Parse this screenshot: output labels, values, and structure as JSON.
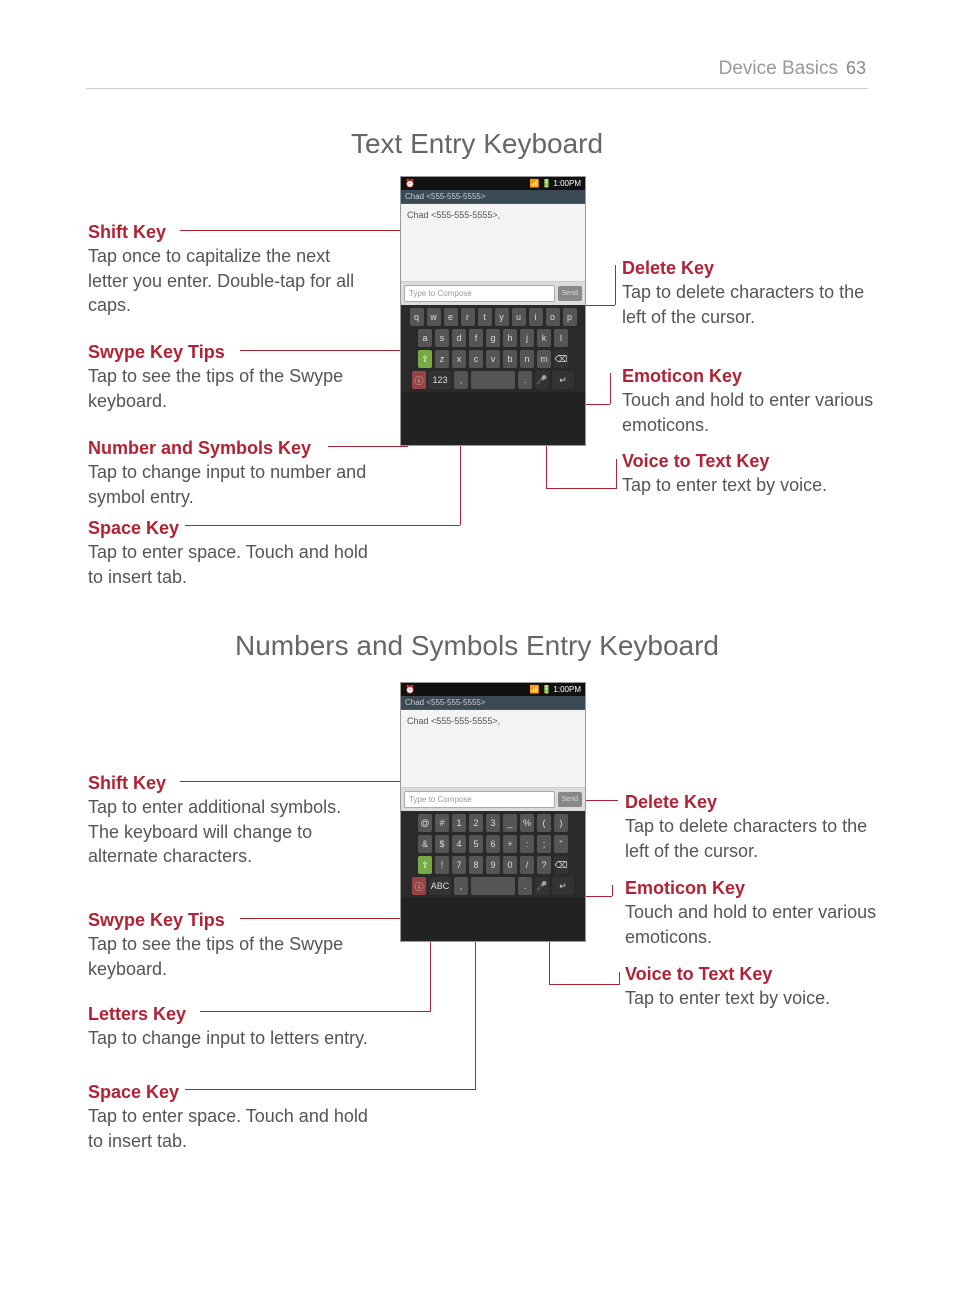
{
  "header": {
    "section": "Device Basics",
    "page": "63"
  },
  "s1": {
    "title": "Text Entry Keyboard",
    "left": {
      "shift": {
        "h": "Shift Key",
        "t": "Tap once to capitalize the next letter you enter. Double-tap for all caps."
      },
      "swype": {
        "h": "Swype Key Tips",
        "t": "Tap to see the tips of the Swype keyboard."
      },
      "numsym": {
        "h": "Number and Symbols Key",
        "t": "Tap to change input to number and symbol entry."
      },
      "space": {
        "h": "Space Key",
        "t": "Tap to enter space. Touch and hold to insert tab."
      }
    },
    "right": {
      "delete": {
        "h": "Delete Key",
        "t": "Tap to delete characters to the left of the cursor."
      },
      "emot": {
        "h": "Emoticon Key",
        "t": "Touch and hold to enter various emoticons."
      },
      "voice": {
        "h": "Voice to Text Key",
        "t": "Tap to enter text by voice."
      }
    }
  },
  "s2": {
    "title": "Numbers and Symbols Entry Keyboard",
    "left": {
      "shift": {
        "h": "Shift Key",
        "t": "Tap to enter additional symbols. The keyboard will change to alternate characters."
      },
      "swype": {
        "h": "Swype Key Tips",
        "t": "Tap to see the tips of the Swype keyboard."
      },
      "letters": {
        "h": "Letters Key",
        "t": "Tap to change input to letters entry."
      },
      "space": {
        "h": "Space Key",
        "t": "Tap to enter space. Touch and hold to insert tab."
      }
    },
    "right": {
      "delete": {
        "h": "Delete Key",
        "t": "Tap to delete characters to the left of the cursor."
      },
      "emot": {
        "h": "Emoticon Key",
        "t": "Touch and hold to enter various emoticons."
      },
      "voice": {
        "h": "Voice to Text Key",
        "t": "Tap to enter text by voice."
      }
    }
  },
  "phone": {
    "status_time": "1:00PM",
    "titlebar": "Chad <555-555-5555>",
    "msg": "Chad <555-555-5555>,",
    "compose_placeholder": "Type to Compose",
    "send": "Send",
    "rows_text": [
      [
        "q",
        "w",
        "e",
        "r",
        "t",
        "y",
        "u",
        "i",
        "o",
        "p"
      ],
      [
        "a",
        "s",
        "d",
        "f",
        "g",
        "h",
        "j",
        "k",
        "l"
      ],
      [
        "⇧",
        "z",
        "x",
        "c",
        "v",
        "b",
        "n",
        "m",
        "⌫"
      ],
      [
        "ⓘ",
        "123",
        ",",
        "␣",
        ".",
        "🎤",
        "↵"
      ]
    ],
    "rows_numsym": [
      [
        "@",
        "#",
        "1",
        "2",
        "3",
        "_",
        "%",
        "(",
        ")"
      ],
      [
        "&",
        "$",
        "4",
        "5",
        "6",
        "+",
        ":",
        ";",
        "\""
      ],
      [
        "⇧",
        "!",
        "7",
        "8",
        "9",
        "0",
        "/",
        "?",
        "⌫"
      ],
      [
        "ⓘ",
        "ABC",
        ",",
        "␣",
        ".",
        "🎤",
        "↵"
      ]
    ]
  }
}
